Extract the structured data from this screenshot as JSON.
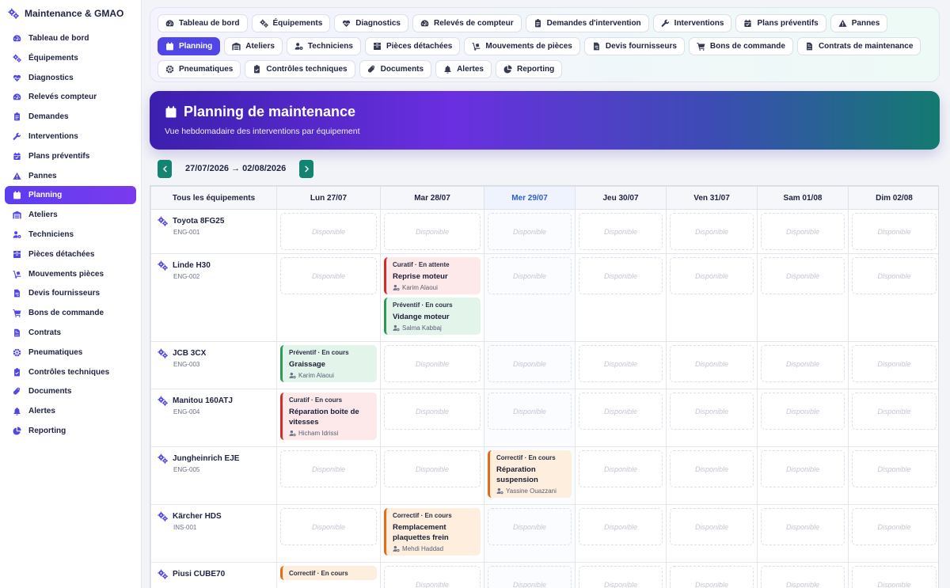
{
  "app": {
    "title": "Maintenance & GMAO"
  },
  "sidebar": {
    "items": [
      {
        "label": "Tableau de bord",
        "icon": "gauge-icon",
        "active": false
      },
      {
        "label": "Équipements",
        "icon": "cogs-icon",
        "active": false
      },
      {
        "label": "Diagnostics",
        "icon": "heartbeat-icon",
        "active": false
      },
      {
        "label": "Relevés compteur",
        "icon": "gauge-icon",
        "active": false
      },
      {
        "label": "Demandes",
        "icon": "clipboard-icon",
        "active": false
      },
      {
        "label": "Interventions",
        "icon": "wrench-icon",
        "active": false
      },
      {
        "label": "Plans préventifs",
        "icon": "calendar-check-icon",
        "active": false
      },
      {
        "label": "Pannes",
        "icon": "warning-icon",
        "active": false
      },
      {
        "label": "Planning",
        "icon": "calendar-icon",
        "active": true
      },
      {
        "label": "Ateliers",
        "icon": "warehouse-icon",
        "active": false
      },
      {
        "label": "Techniciens",
        "icon": "users-gear-icon",
        "active": false
      },
      {
        "label": "Pièces détachées",
        "icon": "boxes-icon",
        "active": false
      },
      {
        "label": "Mouvements pièces",
        "icon": "dolly-icon",
        "active": false
      },
      {
        "label": "Devis fournisseurs",
        "icon": "file-invoice-icon",
        "active": false
      },
      {
        "label": "Bons de commande",
        "icon": "cart-icon",
        "active": false
      },
      {
        "label": "Contrats",
        "icon": "file-contract-icon",
        "active": false
      },
      {
        "label": "Pneumatiques",
        "icon": "tire-icon",
        "active": false
      },
      {
        "label": "Contrôles techniques",
        "icon": "clipboard-check-icon",
        "active": false
      },
      {
        "label": "Documents",
        "icon": "paperclip-icon",
        "active": false
      },
      {
        "label": "Alertes",
        "icon": "bell-icon",
        "active": false
      },
      {
        "label": "Reporting",
        "icon": "pie-chart-icon",
        "active": false
      }
    ]
  },
  "tabs": [
    {
      "label": "Tableau de bord",
      "icon": "gauge-icon",
      "active": false
    },
    {
      "label": "Équipements",
      "icon": "cogs-icon",
      "active": false
    },
    {
      "label": "Diagnostics",
      "icon": "heartbeat-icon",
      "active": false
    },
    {
      "label": "Relevés de compteur",
      "icon": "gauge-icon",
      "active": false
    },
    {
      "label": "Demandes d'intervention",
      "icon": "clipboard-icon",
      "active": false
    },
    {
      "label": "Interventions",
      "icon": "wrench-icon",
      "active": false
    },
    {
      "label": "Plans préventifs",
      "icon": "calendar-check-icon",
      "active": false
    },
    {
      "label": "Pannes",
      "icon": "warning-icon",
      "active": false
    },
    {
      "label": "Planning",
      "icon": "calendar-icon",
      "active": true
    },
    {
      "label": "Ateliers",
      "icon": "warehouse-icon",
      "active": false
    },
    {
      "label": "Techniciens",
      "icon": "users-gear-icon",
      "active": false
    },
    {
      "label": "Pièces détachées",
      "icon": "boxes-icon",
      "active": false
    },
    {
      "label": "Mouvements de pièces",
      "icon": "dolly-icon",
      "active": false
    },
    {
      "label": "Devis fournisseurs",
      "icon": "file-invoice-icon",
      "active": false
    },
    {
      "label": "Bons de commande",
      "icon": "cart-icon",
      "active": false
    },
    {
      "label": "Contrats de maintenance",
      "icon": "file-contract-icon",
      "active": false
    },
    {
      "label": "Pneumatiques",
      "icon": "tire-icon",
      "active": false
    },
    {
      "label": "Contrôles techniques",
      "icon": "clipboard-check-icon",
      "active": false
    },
    {
      "label": "Documents",
      "icon": "paperclip-icon",
      "active": false
    },
    {
      "label": "Alertes",
      "icon": "bell-icon",
      "active": false
    },
    {
      "label": "Reporting",
      "icon": "pie-chart-icon",
      "active": false
    }
  ],
  "hero": {
    "title": "Planning de maintenance",
    "subtitle": "Vue hebdomadaire des interventions par équipement"
  },
  "week": {
    "range": "27/07/2026 → 02/08/2026"
  },
  "planning": {
    "equipment_header": "Tous les équipements",
    "empty_label": "Disponible",
    "days": [
      {
        "label": "Lun 27/07",
        "today": false
      },
      {
        "label": "Mar 28/07",
        "today": false
      },
      {
        "label": "Mer 29/07",
        "today": true
      },
      {
        "label": "Jeu 30/07",
        "today": false
      },
      {
        "label": "Ven 31/07",
        "today": false
      },
      {
        "label": "Sam 01/08",
        "today": false
      },
      {
        "label": "Dim 02/08",
        "today": false
      }
    ],
    "rows": [
      {
        "name": "Toyota 8FG25",
        "code": "ENG-001",
        "cells": [
          [],
          [],
          [],
          [],
          [],
          [],
          []
        ]
      },
      {
        "name": "Linde H30",
        "code": "ENG-002",
        "cells": [
          [],
          [
            {
              "type": "curatif",
              "meta": "Curatif · En attente",
              "title": "Reprise moteur",
              "tech": "Karim Alaoui"
            },
            {
              "type": "preventif",
              "meta": "Préventif · En cours",
              "title": "Vidange moteur",
              "tech": "Salma Kabbaj"
            }
          ],
          [],
          [],
          [],
          [],
          []
        ]
      },
      {
        "name": "JCB 3CX",
        "code": "ENG-003",
        "cells": [
          [
            {
              "type": "preventif",
              "meta": "Préventif · En cours",
              "title": "Graissage",
              "tech": "Karim Alaoui"
            }
          ],
          [],
          [],
          [],
          [],
          [],
          []
        ]
      },
      {
        "name": "Manitou 160ATJ",
        "code": "ENG-004",
        "cells": [
          [
            {
              "type": "curatif",
              "meta": "Curatif · En cours",
              "title": "Réparation boite de vitesses",
              "tech": "Hicham Idrissi"
            }
          ],
          [],
          [],
          [],
          [],
          [],
          []
        ]
      },
      {
        "name": "Jungheinrich EJE",
        "code": "ENG-005",
        "cells": [
          [],
          [],
          [
            {
              "type": "correctif",
              "meta": "Correctif · En cours",
              "title": "Réparation suspension",
              "tech": "Yassine Ouazzani"
            }
          ],
          [],
          [],
          [],
          []
        ]
      },
      {
        "name": "Kärcher HDS",
        "code": "INS-001",
        "cells": [
          [],
          [
            {
              "type": "correctif",
              "meta": "Correctif · En cours",
              "title": "Remplacement plaquettes frein",
              "tech": "Mehdi Haddad"
            }
          ],
          [],
          [],
          [],
          [],
          []
        ]
      },
      {
        "name": "Piusi CUBE70",
        "code": "",
        "cells": [
          [
            {
              "type": "correctif",
              "meta": "Correctif · En cours",
              "title": "",
              "tech": ""
            }
          ],
          [],
          [],
          [],
          [],
          [],
          []
        ]
      }
    ]
  }
}
